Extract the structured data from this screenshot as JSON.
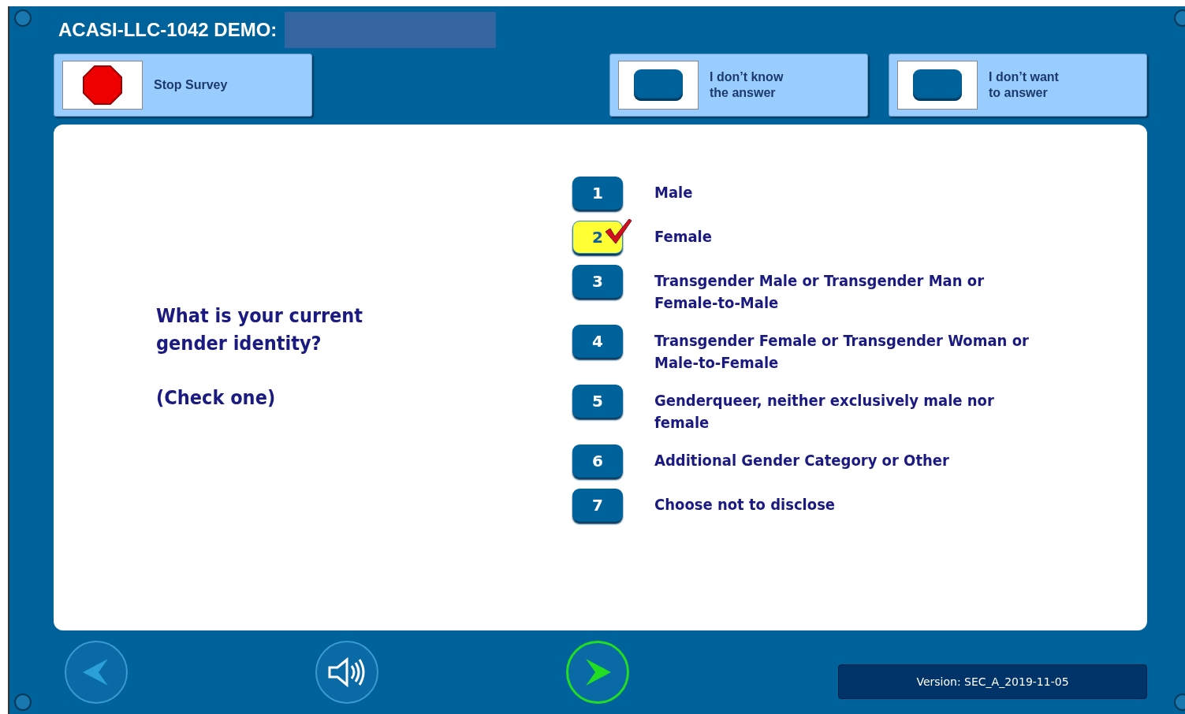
{
  "header": {
    "title": "ACASI-LLC-1042 DEMO:"
  },
  "actions": [
    {
      "kind": "stop",
      "label": "Stop Survey"
    },
    {
      "kind": "blank",
      "label": "I don’t know\nthe answer"
    },
    {
      "kind": "blank",
      "label": "I don’t want\nto answer"
    }
  ],
  "question": {
    "text": "What is your current\ngender identity?",
    "instruction": "(Check one)"
  },
  "options": [
    {
      "number": "1",
      "label": "Male",
      "selected": false
    },
    {
      "number": "2",
      "label": "Female",
      "selected": true
    },
    {
      "number": "3",
      "label": "Transgender Male or Transgender Man or\nFemale-to-Male",
      "selected": false
    },
    {
      "number": "4",
      "label": "Transgender Female or Transgender Woman or\nMale-to-Female",
      "selected": false
    },
    {
      "number": "5",
      "label": "Genderqueer, neither exclusively male nor\nfemale",
      "selected": false
    },
    {
      "number": "6",
      "label": "Additional Gender Category or Other",
      "selected": false
    },
    {
      "number": "7",
      "label": "Choose not to disclose",
      "selected": false
    }
  ],
  "version": "Version: SEC_A_2019-11-05"
}
